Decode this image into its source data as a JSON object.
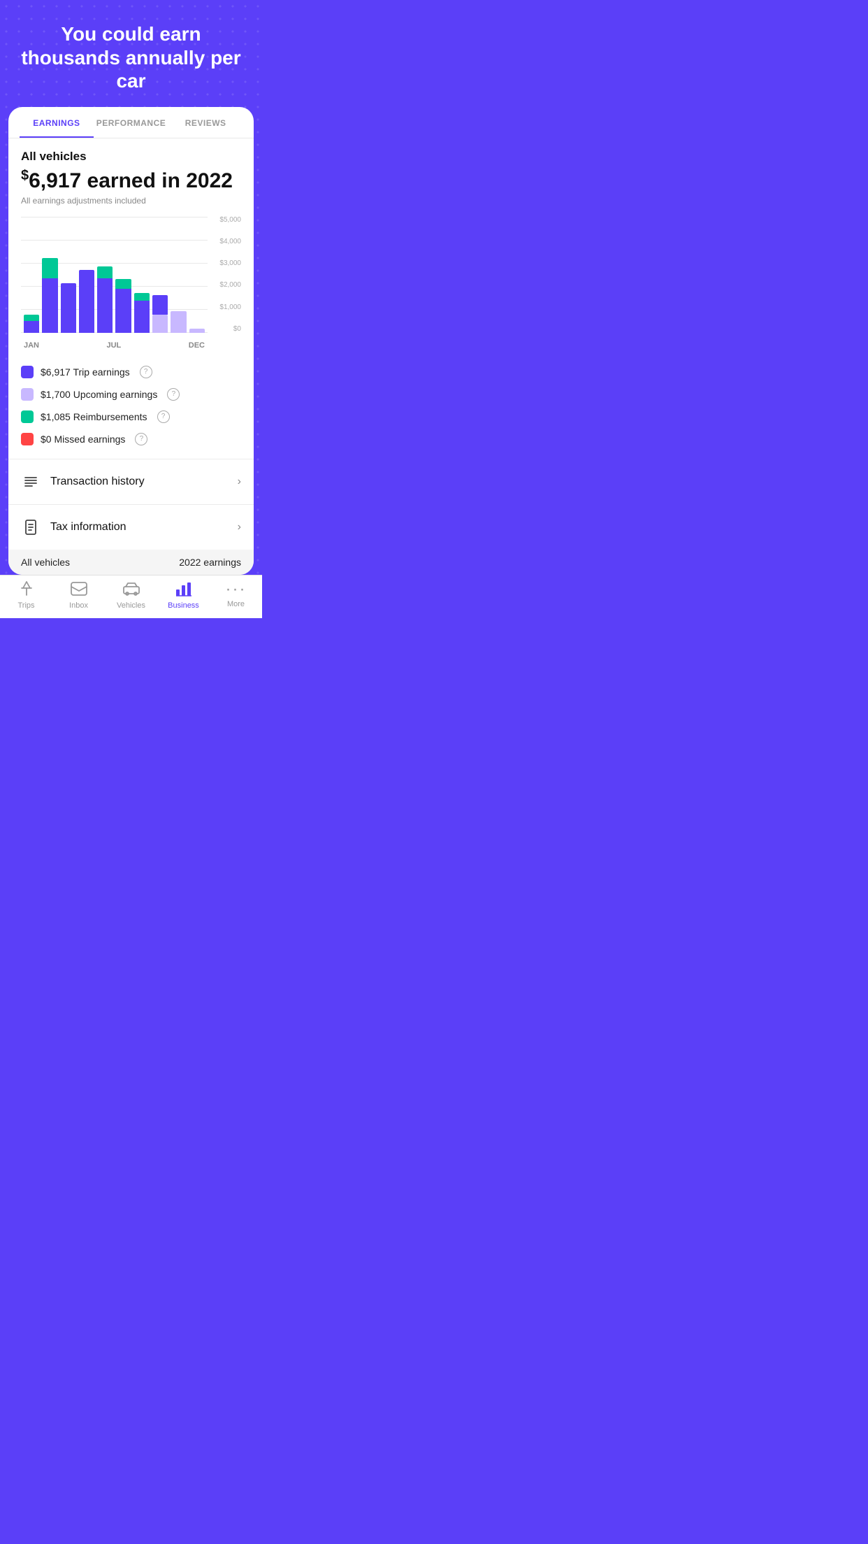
{
  "hero": {
    "title": "You could earn thousands annually per car"
  },
  "tabs": [
    {
      "id": "earnings",
      "label": "EARNINGS",
      "active": true
    },
    {
      "id": "performance",
      "label": "PERFORMANCE",
      "active": false
    },
    {
      "id": "reviews",
      "label": "REVIEWS",
      "active": false
    }
  ],
  "card": {
    "vehicles_label": "All vehicles",
    "earnings_amount": "$6,917 earned in 2022",
    "earnings_dollar": "$",
    "earnings_main": "6,917 earned in 2022",
    "earnings_sub": "All earnings adjustments included",
    "chart": {
      "y_labels": [
        "$5,000",
        "$4,000",
        "$3,000",
        "$2,000",
        "$1,000",
        "$0"
      ],
      "x_labels": [
        "JAN",
        "JUL",
        "DEC"
      ],
      "bars": [
        {
          "blue": 12,
          "green": 6,
          "light": 0
        },
        {
          "blue": 55,
          "green": 20,
          "light": 0
        },
        {
          "blue": 48,
          "green": 0,
          "light": 0
        },
        {
          "blue": 62,
          "green": 0,
          "light": 0
        },
        {
          "blue": 55,
          "green": 12,
          "light": 0
        },
        {
          "blue": 45,
          "green": 10,
          "light": 0
        },
        {
          "blue": 32,
          "green": 8,
          "light": 0
        },
        {
          "blue": 20,
          "green": 0,
          "light": 18
        },
        {
          "blue": 0,
          "green": 0,
          "light": 22
        },
        {
          "blue": 0,
          "green": 0,
          "light": 4
        }
      ]
    },
    "legend": [
      {
        "id": "trip",
        "color": "#5B3FF8",
        "label": "$6,917 Trip earnings"
      },
      {
        "id": "upcoming",
        "color": "#C8B8FF",
        "label": "$1,700 Upcoming earnings"
      },
      {
        "id": "reimbursements",
        "color": "#00C896",
        "label": "$1,085 Reimbursements"
      },
      {
        "id": "missed",
        "color": "#FF4444",
        "label": "$0 Missed earnings"
      }
    ]
  },
  "menu": [
    {
      "id": "transaction-history",
      "label": "Transaction history",
      "icon": "list"
    },
    {
      "id": "tax-information",
      "label": "Tax information",
      "icon": "doc"
    }
  ],
  "filter": {
    "left": "All vehicles",
    "right": "2022 earnings"
  },
  "nav": [
    {
      "id": "trips",
      "label": "Trips",
      "icon": "trips",
      "active": false
    },
    {
      "id": "inbox",
      "label": "Inbox",
      "icon": "inbox",
      "active": false
    },
    {
      "id": "vehicles",
      "label": "Vehicles",
      "icon": "vehicles",
      "active": false
    },
    {
      "id": "business",
      "label": "Business",
      "icon": "business",
      "active": true
    },
    {
      "id": "more",
      "label": "More",
      "icon": "more",
      "active": false
    }
  ]
}
